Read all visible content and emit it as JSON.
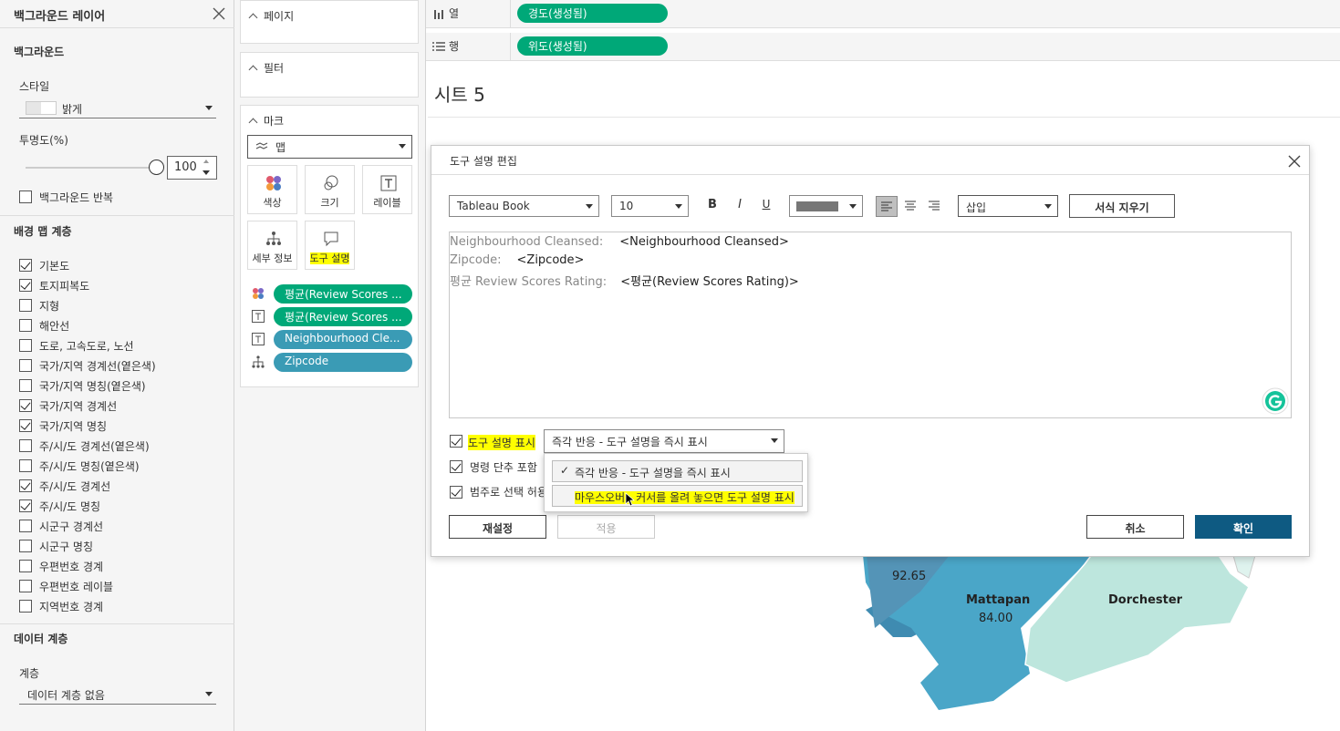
{
  "bg_panel": {
    "title": "백그라운드 레이어",
    "background_section": "백그라운드",
    "style_label": "스타일",
    "style_value": "밝게",
    "opacity_label": "투명도(%)",
    "opacity_value": "100",
    "opacity_level": 1.0,
    "repeat_label": "백그라운드 반복",
    "map_layers_section": "배경 맵 계층",
    "layers": [
      {
        "label": "기본도",
        "checked": true
      },
      {
        "label": "토지피복도",
        "checked": true
      },
      {
        "label": "지형",
        "checked": false
      },
      {
        "label": "해안선",
        "checked": false
      },
      {
        "label": "도로, 고속도로, 노선",
        "checked": false
      },
      {
        "label": "국가/지역 경계선(옅은색)",
        "checked": false
      },
      {
        "label": "국가/지역 명칭(옅은색)",
        "checked": false
      },
      {
        "label": "국가/지역 경계선",
        "checked": true
      },
      {
        "label": "국가/지역 명칭",
        "checked": true
      },
      {
        "label": "주/시/도 경계선(옅은색)",
        "checked": false
      },
      {
        "label": "주/시/도 명칭(옅은색)",
        "checked": false
      },
      {
        "label": "주/시/도 경계선",
        "checked": true
      },
      {
        "label": "주/시/도 명칭",
        "checked": true
      },
      {
        "label": "시군구 경계선",
        "checked": false
      },
      {
        "label": "시군구 명칭",
        "checked": false
      },
      {
        "label": "우편번호 경계",
        "checked": false
      },
      {
        "label": "우편번호 레이블",
        "checked": false
      },
      {
        "label": "지역번호 경계",
        "checked": false
      }
    ],
    "data_layers_section": "데이터 계층",
    "layer_label": "계층",
    "layer_value": "데이터 계층 없음"
  },
  "shelves": {
    "pages": "페이지",
    "filters": "필터",
    "marks": "마크",
    "mark_type": "맵",
    "buttons": {
      "color": "색상",
      "size": "크기",
      "label": "레이블",
      "detail": "세부 정보",
      "tooltip": "도구 설명"
    },
    "fields": [
      {
        "text": "평균(Review Scores ...",
        "style": "green",
        "icon": "color-icon"
      },
      {
        "text": "평균(Review Scores ...",
        "style": "green",
        "icon": "text-label-icon"
      },
      {
        "text": "Neighbourhood Cle...",
        "style": "blue",
        "icon": "text-label-icon"
      },
      {
        "text": "Zipcode",
        "style": "blue",
        "icon": "detail-icon"
      }
    ]
  },
  "columns_row": {
    "label": "열",
    "pill": "경도(생성됨)"
  },
  "rows_row": {
    "label": "행",
    "pill": "위도(생성됨)"
  },
  "sheet": {
    "title": "시트 5"
  },
  "map_labels": [
    {
      "name": "Mattapan",
      "value": "84.00"
    },
    {
      "name": "Dorchester"
    },
    {
      "value": "92.65"
    }
  ],
  "dialog": {
    "title": "도구 설명 편집",
    "font": "Tableau Book",
    "size": "10",
    "insert": "삽입",
    "clear_format": "서식 지우기",
    "content": [
      {
        "key": "Neighbourhood Cleansed:",
        "value": "<Neighbourhood Cleansed>"
      },
      {
        "key": "Zipcode:",
        "value": "<Zipcode>"
      },
      {
        "key": "평균 Review Scores Rating:",
        "value": "<평균(Review Scores Rating)>"
      }
    ],
    "show_tooltip": "도구 설명 표시",
    "show_mode": "즉각 반응 - 도구 설명을 즉시 표시",
    "include_commands": "명령 단추 포함",
    "allow_select": "범주로 선택 허용",
    "reset": "재설정",
    "apply": "적용",
    "cancel": "취소",
    "ok": "확인",
    "options": [
      "즉각 반응 - 도구 설명을 즉시 표시",
      "마우스오버 - 커서를 올려 놓으면 도구 설명 표시"
    ],
    "colors": {
      "ok_button": "#0e5a82",
      "highlight": "#ffff00",
      "green_pill": "#00a878",
      "blue_pill": "#3a9bb5"
    }
  }
}
